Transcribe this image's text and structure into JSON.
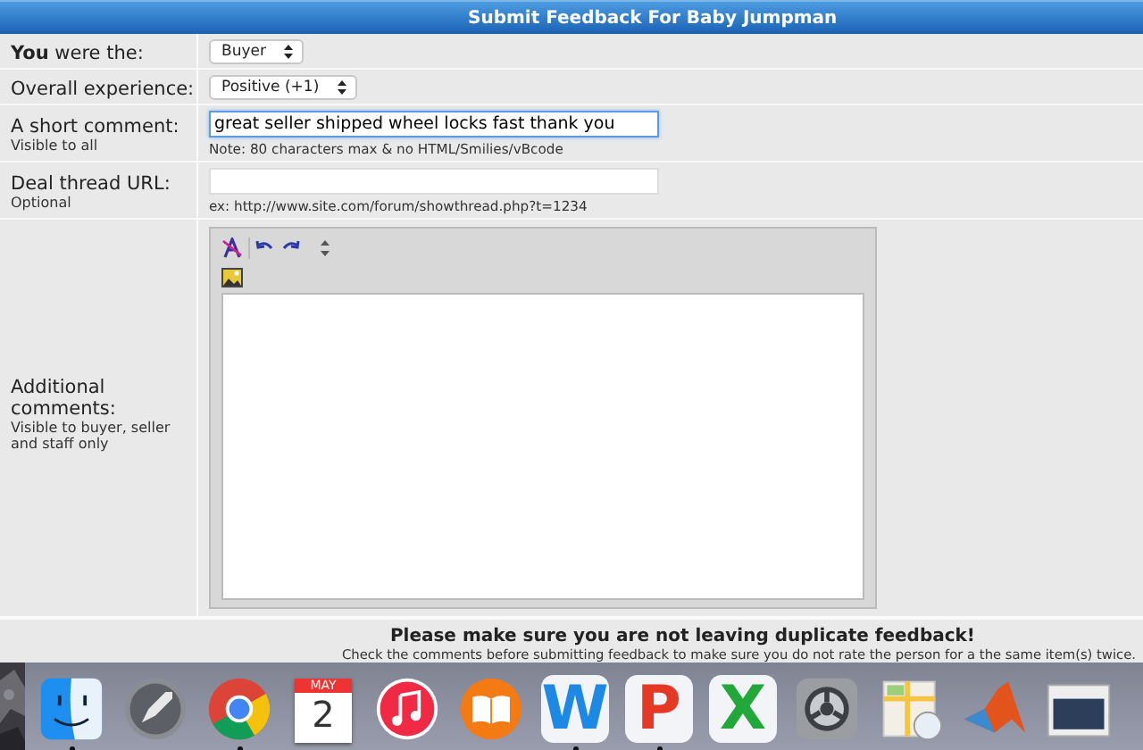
{
  "header": {
    "title": "Submit Feedback For Baby Jumpman"
  },
  "rows": [
    {
      "kind": "select",
      "label": "**You** were the:",
      "value": "Buyer"
    },
    {
      "kind": "select",
      "label": "Overall experience:",
      "value": "Positive (+1)"
    },
    {
      "kind": "text",
      "label": "A short comment:",
      "sublabel": "Visible to all",
      "value": "great seller shipped wheel locks fast thank you",
      "focused": true,
      "note": "Note: 80 characters max & no HTML/Smilies/vBcode"
    },
    {
      "kind": "text",
      "label": "Deal thread URL:",
      "sublabel": "Optional",
      "focused": false,
      "note": "ex: http://www.site.com/forum/showthread.php?t=1234"
    },
    {
      "kind": "editor",
      "label": "Additional comments:",
      "sublabel": "Visible to buyer, seller and staff only"
    }
  ],
  "notice": {
    "heading": "Please make sure you are not leaving duplicate feedback!",
    "text": "Check the comments before submitting feedback to make sure you do not rate the person for a the same item(s) twice."
  },
  "dock": {
    "items": [
      {
        "kind": "finder",
        "running": true
      },
      {
        "kind": "launchpad",
        "running": false
      },
      {
        "kind": "chrome",
        "running": true
      },
      {
        "kind": "calendar",
        "running": false,
        "month": "MAY",
        "day": "2"
      },
      {
        "kind": "music",
        "running": false
      },
      {
        "kind": "books",
        "running": false
      },
      {
        "kind": "letter",
        "running": true,
        "letter": "W",
        "color": "#1e88e5"
      },
      {
        "kind": "letter",
        "running": true,
        "letter": "P",
        "color": "#e53925"
      },
      {
        "kind": "letter",
        "running": false,
        "letter": "X",
        "color": "#22a83a"
      },
      {
        "kind": "settings",
        "running": false
      },
      {
        "kind": "maps",
        "running": false
      },
      {
        "kind": "matlab",
        "running": false
      },
      {
        "kind": "window",
        "running": false
      }
    ]
  }
}
